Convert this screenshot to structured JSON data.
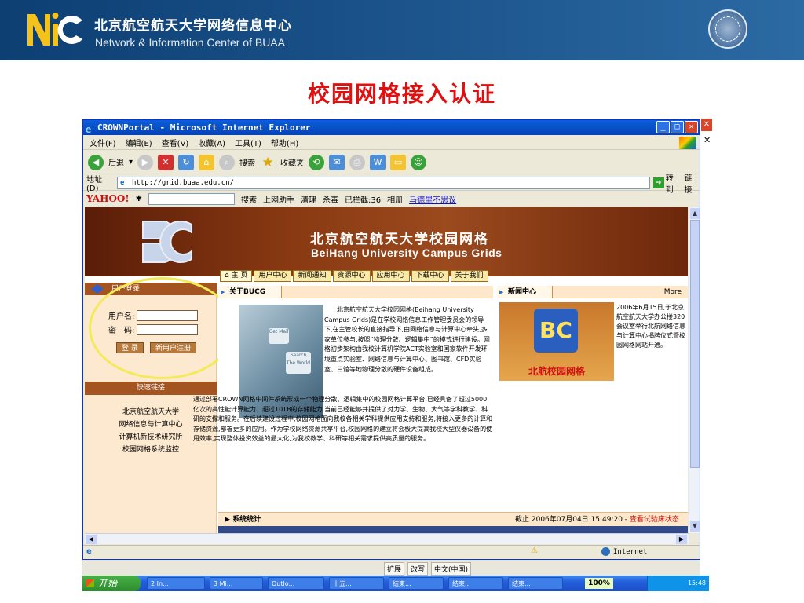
{
  "banner": {
    "title_cn": "北京航空航天大学网络信息中心",
    "title_en": "Network & Information Center of BUAA"
  },
  "slide_title": "校园网格接入认证",
  "ie": {
    "window_title": "CROWNPortal - Microsoft Internet Explorer",
    "menu": [
      "文件(F)",
      "编辑(E)",
      "查看(V)",
      "收藏(A)",
      "工具(T)",
      "帮助(H)"
    ],
    "toolbar": {
      "back": "后退",
      "search": "搜索",
      "favorites": "收藏夹"
    },
    "address_label": "地址(D)",
    "address": "http://grid.buaa.edu.cn/",
    "go": "转到",
    "links": "链接",
    "yahoo": {
      "brand": "YAHOO!",
      "search": "搜索",
      "assistant": "上网助手",
      "clean": "清理",
      "antivirus": "杀毒",
      "blocked": "已拦截:36",
      "album": "相册",
      "link": "马德里不思议"
    },
    "status_zone": "Internet"
  },
  "site": {
    "title_cn": "北京航空航天大学校园网格",
    "title_en": "BeiHang University Campus Grids",
    "nav": [
      "主 页",
      "用户中心",
      "新闻通知",
      "资源中心",
      "应用中心",
      "下载中心",
      "关于我们"
    ],
    "login": {
      "head": "用户登录",
      "username_label": "用户名:",
      "password_label": "密　码:",
      "login_btn": "登 录",
      "register_btn": "新用户注册"
    },
    "quick_links": {
      "head": "快速链接",
      "items": [
        "北京航空航天大学",
        "网络信息与计算中心",
        "计算机新技术研究所",
        "校园网格系统监控"
      ]
    },
    "about": {
      "head": "关于BUCG",
      "text": "北京航空航天大学校园网格(Beihang University Campus Grids)是在学校网络信息工作管理委员会的领导下,在主管校长的直接指导下,由网络信息与计算中心牵头,多家单位参与,按照“物理分散、逻辑集中”的模式进行建设。网格初步架构由我校计算机学院ACT实验室和国家软件开发环境重点实验室、网络信息与计算中心、图书馆、CFD实验室、三馆等地物理分散的硬件设备组成。",
      "text2": "通过部署CROWN网格中间件系统形成一个物理分散、逻辑集中的校园网格计算平台,已经具备了超过5000亿次的高性能计算能力、超过10TB的存储能力,当前已经能够并提供了对力学、生物、大气等学科教学、科研的支撑和服务。在后续建设过程中,校园网格面向我校各相关学科提供应用支持和服务,将接入更多的计算和存储资源,部署更多的应用。作为学校网络资源共享平台,校园网格的建立将会极大提高我校大型仪器设备的使用效率,实现整体投资效益的最大化,为我校教学、科研等相关需求提供高质量的服务。",
      "img_keys": [
        "Get Mail",
        "Search The World"
      ]
    },
    "news": {
      "head": "新闻中心",
      "more": "More",
      "img_caption": "北航校园网格",
      "text": "2006年6月15日,于北京航空航天大学办公楼320会议室举行北航网络信息与计算中心揭牌仪式暨校园网格网站开通。"
    },
    "system": {
      "head": "系统统计",
      "date": "截止 2006年07月04日 15:49:20 - ",
      "link": "查看试验床状态"
    }
  },
  "taskbar": {
    "ime": [
      "扩展",
      "改写",
      "中文(中国)"
    ],
    "start": "开始",
    "tasks": [
      "2 In...",
      "3 Mi...",
      "Outlo...",
      "十五...",
      "结束...",
      "结束...",
      "结束..."
    ],
    "zoom": "100%",
    "clock": "15:48"
  }
}
